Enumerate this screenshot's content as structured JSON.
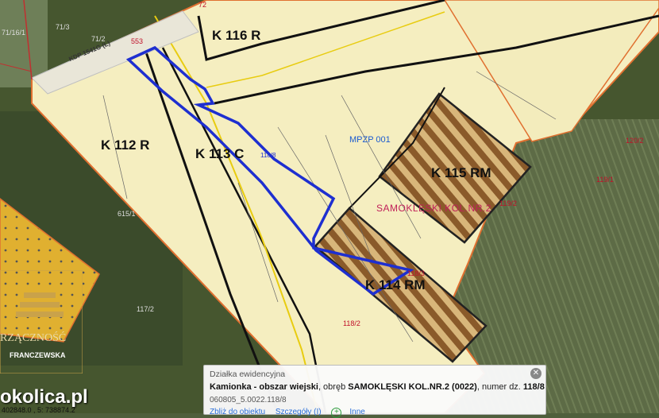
{
  "zones": {
    "k116": "K 116 R",
    "k112": "K 112 R",
    "k113": "K 113 C",
    "k115": "K 115 RM",
    "k114": "K 114 RM",
    "mpzp": "MPZP 001",
    "samok": "SAMOKLĘSKI KOL.NR.2"
  },
  "parcels": {
    "p72": "72",
    "p553": "553",
    "p118_8": "118/8",
    "p120_2": "120/2",
    "p119_1": "119/1",
    "p119_2": "119/2",
    "p118_3": "118/3",
    "p118_2": "118/2",
    "p615_1": "615/1",
    "p117_2": "117/2",
    "p71_3": "71/3",
    "p71_2": "71/2",
    "p71_16": "71/16/1"
  },
  "road": {
    "label": "KDP 1541G (L)"
  },
  "popup": {
    "title": "Działka ewidencyjna",
    "line_prefix": "Kamionka - obszar wiejski",
    "line_mid1": ", obręb ",
    "line_obreb": "SAMOKLĘSKI KOL.NR.2 (0022)",
    "line_mid2": ", numer dz. ",
    "line_num": "118/8",
    "code": "060805_5.0022.118/8",
    "link_zoom": "Zbliż do obiektu",
    "link_details": "Szczegóły (I)",
    "link_more": "Inne",
    "close_icon": "close-icon"
  },
  "logo": {
    "text1": "RZĄCZNOŚĆ",
    "text2": "FRANCZEWSKA"
  },
  "watermark": "okolica.pl",
  "coords": "402848.0 , 5: 738874.2"
}
